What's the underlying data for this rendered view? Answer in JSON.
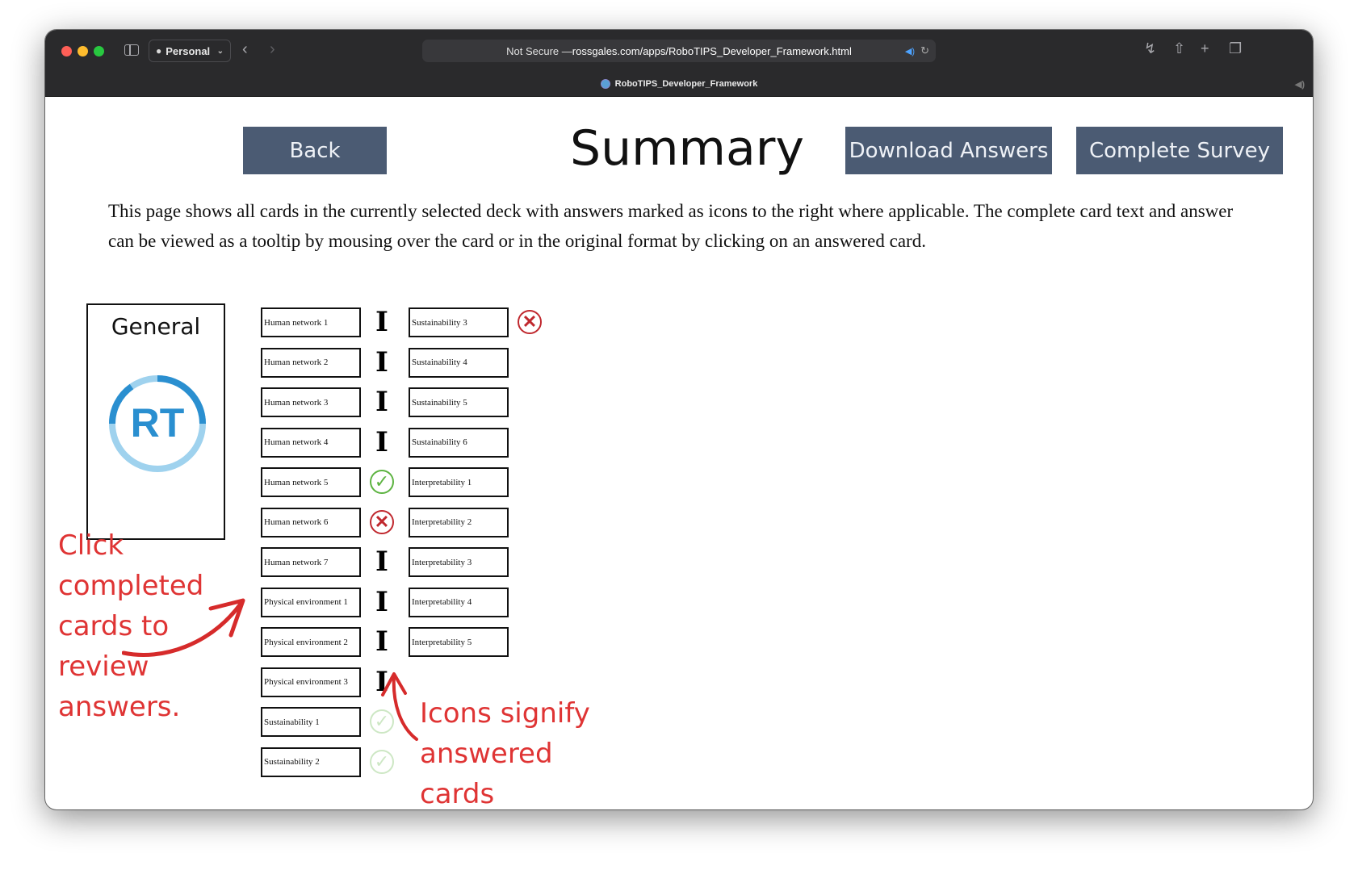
{
  "browser": {
    "profile_label": "Personal",
    "url_prefix": "Not Secure — ",
    "url_host": "rossgales.com/apps/RoboTIPS_Developer_Framework.html",
    "tab_title": "RoboTIPS_Developer_Framework"
  },
  "page": {
    "title": "Summary",
    "back_label": "Back",
    "download_label": "Download Answers",
    "complete_label": "Complete Survey",
    "description": "This page shows all cards in the currently selected deck with answers marked as icons to the right where applicable. The complete card text and answer can be viewed as a tooltip by mousing over the card or in the original format by clicking on an answered card."
  },
  "deck": {
    "title": "General",
    "logo_text": "RT",
    "colors": {
      "logo_primary": "#2a8fd0",
      "logo_light": "#9fd2ee"
    }
  },
  "cards_col1": [
    {
      "label": "Human network 1",
      "answer": "ibeam"
    },
    {
      "label": "Human network 2",
      "answer": "ibeam"
    },
    {
      "label": "Human network 3",
      "answer": "ibeam"
    },
    {
      "label": "Human network 4",
      "answer": "ibeam"
    },
    {
      "label": "Human network 5",
      "answer": "check"
    },
    {
      "label": "Human network 6",
      "answer": "cross"
    },
    {
      "label": "Human network 7",
      "answer": "ibeam"
    },
    {
      "label": "Physical environment 1",
      "answer": "ibeam"
    },
    {
      "label": "Physical environment 2",
      "answer": "ibeam"
    },
    {
      "label": "Physical environment 3",
      "answer": "ibeam"
    },
    {
      "label": "Sustainability 1",
      "answer": "check"
    },
    {
      "label": "Sustainability 2",
      "answer": "check"
    }
  ],
  "cards_col2": [
    {
      "label": "Sustainability 3",
      "answer": "cross"
    },
    {
      "label": "Sustainability 4",
      "answer": ""
    },
    {
      "label": "Sustainability 5",
      "answer": ""
    },
    {
      "label": "Sustainability 6",
      "answer": ""
    },
    {
      "label": "Interpretability 1",
      "answer": ""
    },
    {
      "label": "Interpretability 2",
      "answer": ""
    },
    {
      "label": "Interpretability 3",
      "answer": ""
    },
    {
      "label": "Interpretability 4",
      "answer": ""
    },
    {
      "label": "Interpretability 5",
      "answer": ""
    }
  ],
  "annotations": {
    "left": "Click completed cards to review answers.",
    "bottom": "Icons signify answered cards",
    "color": "#df3434"
  },
  "icons": {
    "ibeam": "I",
    "check": "✓",
    "cross": "✕"
  }
}
